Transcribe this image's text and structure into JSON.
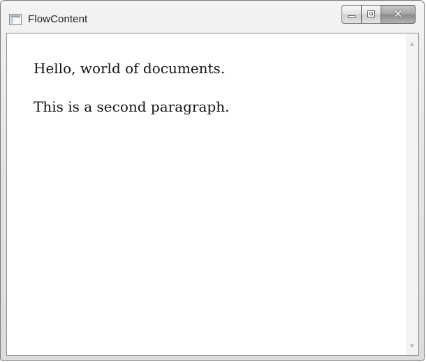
{
  "window": {
    "title": "FlowContent",
    "icon": "app-window-icon",
    "buttons": {
      "minimize": "minimize-icon",
      "maximize": "maximize-icon",
      "close": "close-icon"
    }
  },
  "document": {
    "paragraphs": [
      "Hello, world of documents.",
      "This is a second paragraph."
    ]
  },
  "scrollbar": {
    "up": "▲",
    "down": "▼"
  }
}
